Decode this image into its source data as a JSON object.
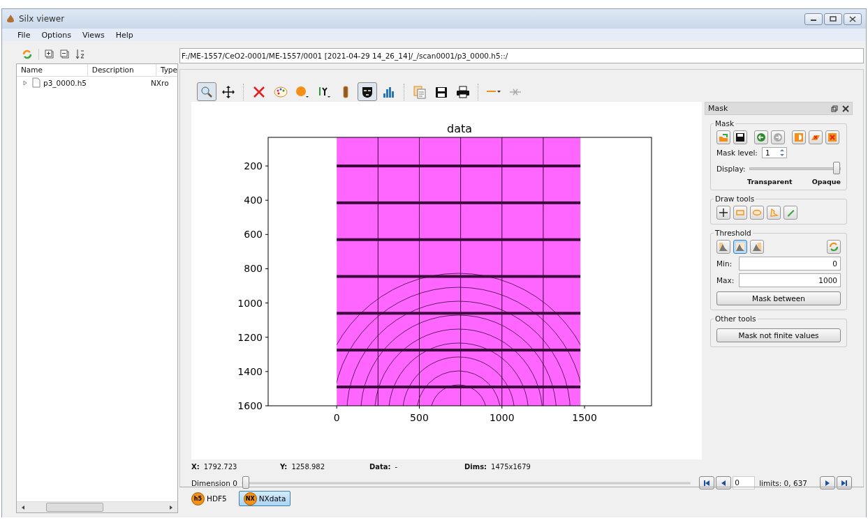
{
  "window": {
    "title": "Silx viewer"
  },
  "menu": [
    "File",
    "Options",
    "Views",
    "Help"
  ],
  "tree": {
    "columns": [
      "Name",
      "Description",
      "Type"
    ],
    "rows": [
      {
        "name": "p3_0000.h5",
        "type": "NXro",
        "expanded": false
      }
    ]
  },
  "path": "F:/ME-1557/CeO2-0001/ME-1557/0001 [2021-04-29 14_26_14]/_/scan0001/p3_0000.h5::/",
  "plot_toolbar": [
    {
      "kind": "zoom",
      "selected": true
    },
    {
      "kind": "pan",
      "selected": false
    },
    {
      "kind": "sep"
    },
    {
      "kind": "reset",
      "selected": false
    },
    {
      "kind": "palette",
      "selected": false
    },
    {
      "kind": "dot",
      "selected": false
    },
    {
      "kind": "yaxis",
      "selected": false
    },
    {
      "kind": "colorbar",
      "selected": false
    },
    {
      "kind": "mask",
      "selected": true
    },
    {
      "kind": "histogram",
      "selected": false
    },
    {
      "kind": "sep"
    },
    {
      "kind": "copy",
      "selected": false
    },
    {
      "kind": "save",
      "selected": false
    },
    {
      "kind": "print",
      "selected": false
    },
    {
      "kind": "sep"
    },
    {
      "kind": "line",
      "selected": false
    },
    {
      "kind": "crosshair",
      "selected": false
    }
  ],
  "plot": {
    "title": "data",
    "yticks": [
      "200",
      "400",
      "600",
      "800",
      "1000",
      "1200",
      "1400",
      "1600"
    ],
    "xticks": [
      "0",
      "500",
      "1000",
      "1500"
    ]
  },
  "status": [
    {
      "label": "X:",
      "value": "1792.723"
    },
    {
      "label": "Y:",
      "value": "1258.982"
    },
    {
      "label": "Data:",
      "value": "-"
    },
    {
      "label": "Dims:",
      "value": "1475x1679"
    }
  ],
  "dimension": {
    "label": "Dimension 0",
    "level": 0,
    "value": "0",
    "limits": "limits: 0, 637"
  },
  "mask_panel": {
    "title": "Mask",
    "mask": {
      "title": "Mask",
      "level_label": "Mask level:",
      "level_value": "1",
      "display_label": "Display:",
      "level": 1,
      "left": "Transparent",
      "right": "Opaque"
    },
    "draw_tools": {
      "title": "Draw tools",
      "tools": [
        {
          "kind": "pan",
          "selected": false
        },
        {
          "kind": "rect",
          "selected": false
        },
        {
          "kind": "ellipse",
          "selected": false
        },
        {
          "kind": "polygon",
          "selected": false
        },
        {
          "kind": "pencil",
          "selected": false
        }
      ]
    },
    "threshold": {
      "title": "Threshold",
      "modes": [
        {
          "selected": false
        },
        {
          "selected": true
        },
        {
          "selected": false
        }
      ],
      "min_label": "Min:",
      "min": "0",
      "max_label": "Max:",
      "max": "1000",
      "button": "Mask between"
    },
    "other": {
      "title": "Other tools",
      "button": "Mask not finite values"
    }
  },
  "tabs": [
    {
      "label": "HDF5",
      "badge": "h5",
      "selected": false
    },
    {
      "label": "NXdata",
      "badge": "NX",
      "selected": true
    }
  ]
}
